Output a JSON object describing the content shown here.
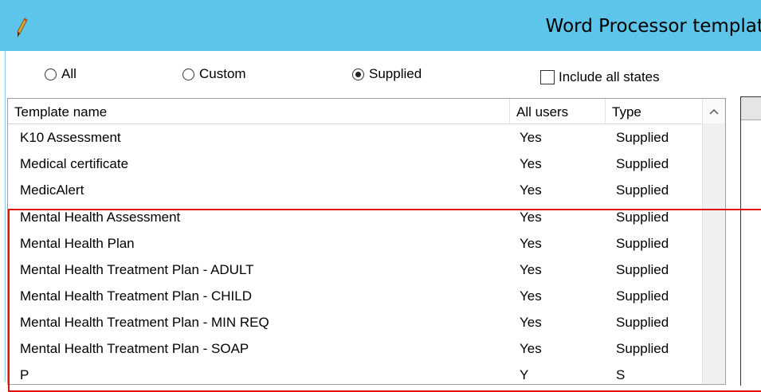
{
  "window": {
    "title": "Word Processor templates",
    "app_icon": "pen-icon"
  },
  "filters": {
    "radios": [
      {
        "label": "All",
        "checked": false
      },
      {
        "label": "Custom",
        "checked": false
      },
      {
        "label": "Supplied",
        "checked": true
      }
    ],
    "include_all_states": {
      "label": "Include all states",
      "checked": false
    }
  },
  "grid": {
    "columns": [
      "Template name",
      "All users",
      "Type"
    ],
    "rows": [
      {
        "name": "K10 Assessment",
        "all_users": "Yes",
        "type": "Supplied"
      },
      {
        "name": "Medical certificate",
        "all_users": "Yes",
        "type": "Supplied"
      },
      {
        "name": "MedicAlert",
        "all_users": "Yes",
        "type": "Supplied"
      },
      {
        "name": "Mental Health Assessment",
        "all_users": "Yes",
        "type": "Supplied"
      },
      {
        "name": "Mental Health Plan",
        "all_users": "Yes",
        "type": "Supplied"
      },
      {
        "name": "Mental Health Treatment Plan - ADULT",
        "all_users": "Yes",
        "type": "Supplied"
      },
      {
        "name": "Mental Health Treatment Plan - CHILD",
        "all_users": "Yes",
        "type": "Supplied"
      },
      {
        "name": "Mental Health Treatment Plan - MIN REQ",
        "all_users": "Yes",
        "type": "Supplied"
      },
      {
        "name": "Mental Health Treatment Plan - SOAP",
        "all_users": "Yes",
        "type": "Supplied"
      },
      {
        "name": "P",
        "all_users": "Y",
        "type": "S"
      }
    ],
    "scroll_up_icon": "chevron-up-icon"
  },
  "highlight": {
    "color": "#e01010"
  }
}
